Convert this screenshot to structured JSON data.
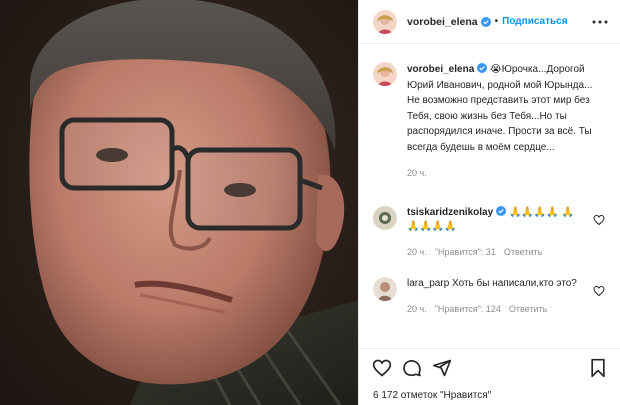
{
  "header": {
    "username": "vorobei_elena",
    "follow_label": "Подписаться",
    "separator": "•"
  },
  "caption": {
    "username": "vorobei_elena",
    "emoji": "😭",
    "text": "Юрочка...Дорогой Юрий Иванович, родной мой Юрында... Не возможно представить этот мир без Тебя, свою жизнь без Тебя...Но ты распорядился иначе. Прости за всё. Ты всегда будешь в моём сердце...",
    "time": "20 ч."
  },
  "comments": [
    {
      "username": "tsiskaridzenikolay",
      "text": "🙏🙏🙏🙏 🙏🙏🙏🙏🙏",
      "time": "20 ч.",
      "likes": "\"Нравится\": 31",
      "reply": "Ответить"
    },
    {
      "username": "lara_parp",
      "text": "Хоть бы написали,кто это?",
      "time": "20 ч.",
      "likes": "\"Нравится\": 124",
      "reply": "Ответить"
    }
  ],
  "footer": {
    "likes_text": "6 172 отметок \"Нравится\""
  },
  "icons": [
    "verified-icon",
    "more-icon",
    "heart-icon",
    "comment-icon",
    "share-icon",
    "bookmark-icon"
  ],
  "colors": {
    "accent": "#0095f6",
    "verified": "#3897f0",
    "muted": "#8e8e8e",
    "text": "#262626"
  }
}
